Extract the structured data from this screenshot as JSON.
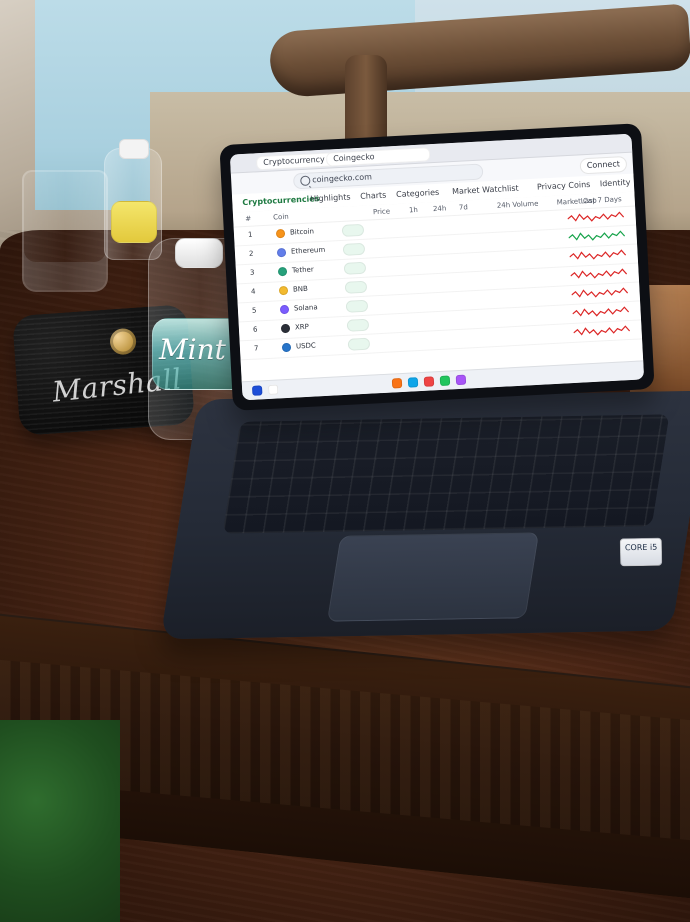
{
  "scene": {
    "speaker_brand": "Marshall",
    "water_brand": "Mint",
    "intel_sticker": "CORE i5"
  },
  "screen": {
    "tabs": [
      "Cryptocurrency Prices, Charts",
      "Coingecko"
    ],
    "address": "coingecko.com",
    "connect_label": "Connect",
    "nav": [
      {
        "label": "Cryptocurrencies",
        "active": true
      },
      {
        "label": "Highlights",
        "active": false
      },
      {
        "label": "Charts",
        "active": false
      },
      {
        "label": "Categories",
        "active": false
      },
      {
        "label": "Market Watchlist",
        "active": false
      },
      {
        "label": "Privacy Coins",
        "active": false
      },
      {
        "label": "Identity",
        "active": false
      }
    ],
    "table": {
      "headers": [
        "#",
        "Coin",
        "Price",
        "1h",
        "24h",
        "7d",
        "24h Volume",
        "Market Cap",
        "Last 7 Days"
      ],
      "rows": [
        {
          "rank": "1",
          "coin": "Bitcoin",
          "color": "#f7931a",
          "price": "",
          "h1": "",
          "h24": "",
          "d7": "",
          "vol": "",
          "mcap": ""
        },
        {
          "rank": "2",
          "coin": "Ethereum",
          "color": "#627eea",
          "price": "",
          "h1": "",
          "h24": "",
          "d7": "",
          "vol": "",
          "mcap": ""
        },
        {
          "rank": "3",
          "coin": "Tether",
          "color": "#26a17b",
          "price": "",
          "h1": "",
          "h24": "",
          "d7": "",
          "vol": "",
          "mcap": ""
        },
        {
          "rank": "4",
          "coin": "BNB",
          "color": "#f3ba2f",
          "price": "",
          "h1": "",
          "h24": "",
          "d7": "",
          "vol": "",
          "mcap": ""
        },
        {
          "rank": "5",
          "coin": "Solana",
          "color": "#7b5cff",
          "price": "",
          "h1": "",
          "h24": "",
          "d7": "",
          "vol": "",
          "mcap": ""
        },
        {
          "rank": "6",
          "coin": "XRP",
          "color": "#2b2f38",
          "price": "",
          "h1": "",
          "h24": "",
          "d7": "",
          "vol": "",
          "mcap": ""
        },
        {
          "rank": "7",
          "coin": "USDC",
          "color": "#2775ca",
          "price": "",
          "h1": "",
          "h24": "",
          "d7": "",
          "vol": "",
          "mcap": ""
        }
      ]
    }
  }
}
